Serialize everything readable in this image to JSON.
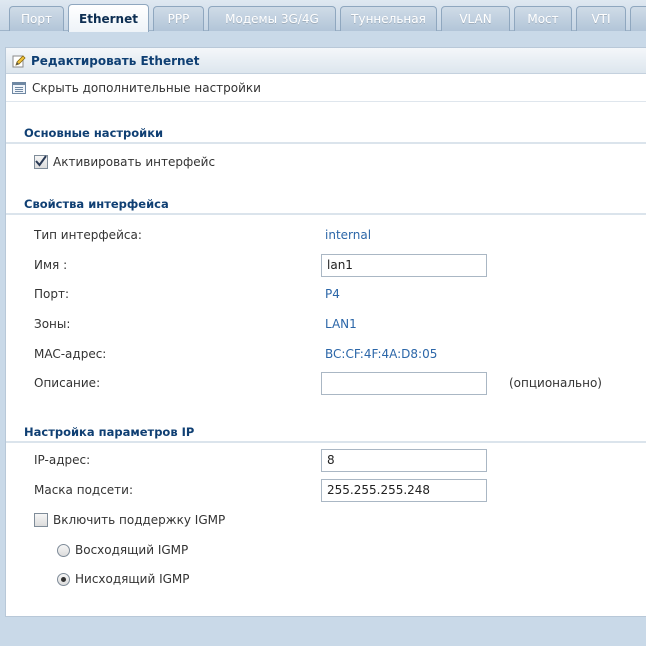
{
  "tabs": [
    {
      "label": "Порт",
      "active": false
    },
    {
      "label": "Ethernet",
      "active": true
    },
    {
      "label": "PPP",
      "active": false
    },
    {
      "label": "Модемы 3G/4G",
      "active": false
    },
    {
      "label": "Туннельная",
      "active": false
    },
    {
      "label": "VLAN",
      "active": false
    },
    {
      "label": "Мост",
      "active": false
    },
    {
      "label": "VTI",
      "active": false
    }
  ],
  "panel": {
    "title": "Редактировать Ethernet",
    "toggle_advanced": "Скрыть дополнительные настройки"
  },
  "basic": {
    "title": "Основные настройки",
    "activate_label": "Активировать интерфейс",
    "activate_checked": true
  },
  "props": {
    "title": "Свойства интерфейса",
    "type_label": "Тип интерфейса:",
    "type_value": "internal",
    "name_label": "Имя :",
    "name_value": "lan1",
    "port_label": "Порт:",
    "port_value": "P4",
    "zones_label": "Зоны:",
    "zones_value": "LAN1",
    "mac_label": "MAC-адрес:",
    "mac_value": "BC:CF:4F:4A:D8:05",
    "desc_label": "Описание:",
    "desc_value": "",
    "desc_hint": "(опционально)"
  },
  "ip": {
    "title": "Настройка параметров IP",
    "ip_label": "IP-адрес:",
    "ip_value": "8",
    "mask_label": "Маска подсети:",
    "mask_value": "255.255.255.248",
    "igmp_label": "Включить поддержку IGMP",
    "igmp_checked": false,
    "upstream_label": "Восходящий IGMP",
    "upstream_selected": false,
    "downstream_label": "Нисходящий IGMP",
    "downstream_selected": true
  },
  "colors": {
    "accent": "#0f3f73",
    "value_text": "#2b66a8",
    "background": "#c9d9e8"
  }
}
